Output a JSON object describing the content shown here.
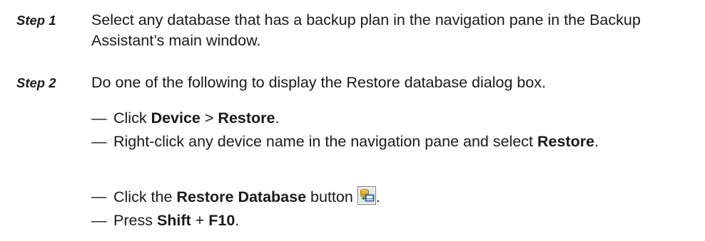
{
  "steps": [
    {
      "label": "Step 1",
      "text": "Select any database that has a backup plan in the navigation pane in the Backup Assistant’s main window."
    },
    {
      "label": "Step 2",
      "text": "Do one of the following to display the Restore database dialog box.",
      "options": [
        {
          "dash": "—",
          "pre": "Click ",
          "bold1": "Device",
          "mid": " > ",
          "bold2": "Restore",
          "post": "."
        },
        {
          "dash": "—",
          "pre": "Right-click any device name in the navigation pane and select ",
          "bold1": "Restore",
          "post": "."
        },
        {
          "dash": "—",
          "pre": "Click the ",
          "bold1": "Restore Database",
          "mid": " button",
          "icon": "restore-database-icon",
          "post": "."
        },
        {
          "dash": "—",
          "pre": "Press ",
          "bold1": "Shift",
          "mid": " + ",
          "bold2": "F10",
          "post": "."
        }
      ]
    }
  ]
}
